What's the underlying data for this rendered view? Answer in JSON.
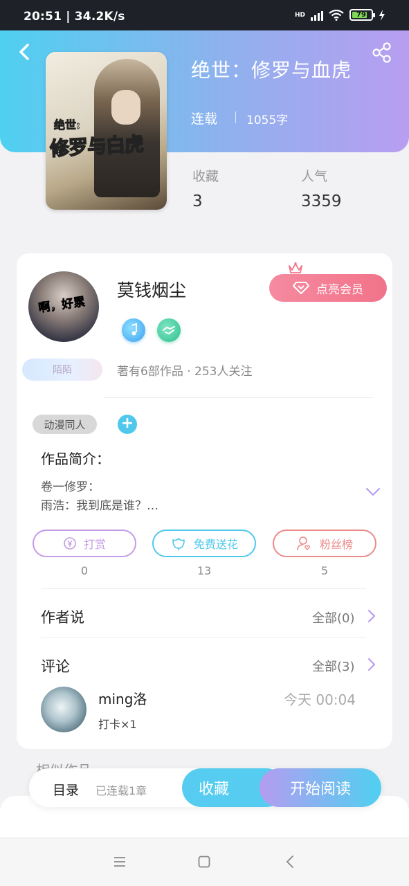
{
  "status_bar": {
    "time": "20:51",
    "speed": "34.2K/s",
    "network": "HD",
    "battery": "79"
  },
  "book": {
    "title": "绝世：修罗与血虎",
    "status": "连载",
    "words": "1055字",
    "cover_text_small": "绝世:",
    "cover_text_big": "修罗与白虎",
    "favorites_label": "收藏",
    "favorites_value": "3",
    "popularity_label": "人气",
    "popularity_value": "3359"
  },
  "author": {
    "avatar_text": "啊，好累",
    "name": "莫钱烟尘",
    "vip_label": "点亮会员",
    "badge_label": "陌陌",
    "stats": "著有6部作品 · 253人关注"
  },
  "tags": [
    "动漫同人"
  ],
  "intro": {
    "label": "作品简介：",
    "line1": "卷一修罗：",
    "line2": "雨浩：我到底是谁？…"
  },
  "actions": [
    {
      "label": "打赏",
      "count": "0",
      "color": "#c49be6"
    },
    {
      "label": "免费送花",
      "count": "13",
      "color": "#4fc8ec"
    },
    {
      "label": "粉丝榜",
      "count": "5",
      "color": "#ec8a8a"
    }
  ],
  "author_says": {
    "title": "作者说",
    "all": "全部(0)"
  },
  "comments": {
    "title": "评论",
    "all": "全部(3)",
    "items": [
      {
        "user": "ming洛",
        "time": "今天 00:04",
        "text": "打卡×1"
      }
    ]
  },
  "similar_label": "相似作品",
  "bottom_bar": {
    "toc": "目录",
    "toc_count": "已连载1章",
    "favorite": "收藏",
    "read": "开始阅读"
  },
  "colors": {
    "accent_blue": "#56cdf0",
    "accent_purple": "#b49cf0",
    "vip_pink": "#f2738a"
  }
}
